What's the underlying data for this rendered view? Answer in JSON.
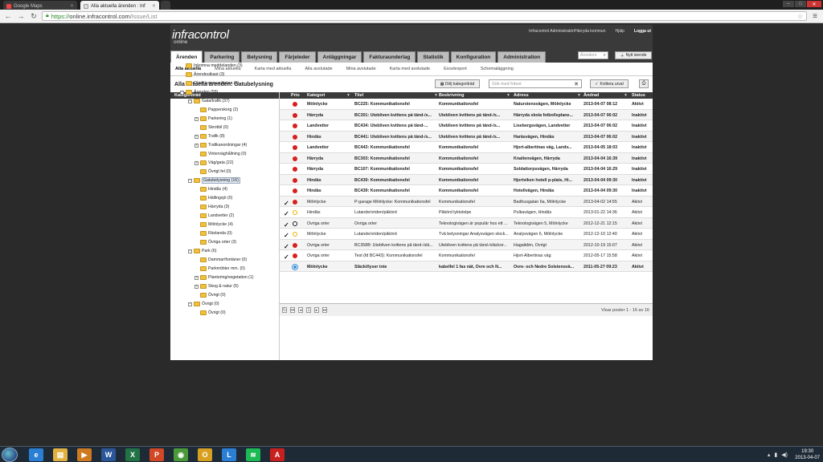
{
  "browser": {
    "tabs": [
      {
        "title": "Google Maps",
        "active": false
      },
      {
        "title": "Alla aktuella ärenden : Inf",
        "active": true
      }
    ],
    "url": {
      "scheme": "https://",
      "host": "online.infracontrol.com",
      "path": "/Issue/List"
    }
  },
  "app": {
    "logo": "infracontrol",
    "logo_sub": "online",
    "user": "Infracontrol Administratör/Härryda kommun",
    "help": "Hjälp",
    "logout": "Logga ut",
    "main_tabs": [
      "Ärenden",
      "Parkering",
      "Belysning",
      "Färjeleder",
      "Anläggningar",
      "Fakturaunderlag",
      "Statistik",
      "Konfiguration",
      "Administration"
    ],
    "search_placeholder": "Ärendenr",
    "new_issue": "Nytt ärende",
    "sub_nav": [
      "Alla aktuella",
      "Mina aktuella",
      "Karta med aktuella",
      "Alla avslutade",
      "Mina avslutade",
      "Karta med avslutade",
      "Excelexport",
      "Schemaläggning"
    ],
    "page_title": "Alla aktuella ärenden: Gatubelysning",
    "hide_tree": "Dölj kategoriträd",
    "freetext_placeholder": "Sök med fritext",
    "ack_button": "Kvittera urval",
    "tree_header": "Kategoriträd",
    "tree": [
      {
        "label": "Inkomna meddelanden (3)",
        "level": 0,
        "toggle": ""
      },
      {
        "label": "Ärendeutkast (3)",
        "level": 0,
        "toggle": ""
      },
      {
        "label": "Oläst kommunikation (1)",
        "level": 0,
        "toggle": ""
      },
      {
        "label": "Ärenden (59)",
        "level": 0,
        "toggle": "−"
      },
      {
        "label": "Gata/trafik (37)",
        "level": 1,
        "toggle": "−"
      },
      {
        "label": "Papperskorg (2)",
        "level": 2,
        "toggle": ""
      },
      {
        "label": "Parkering (1)",
        "level": 2,
        "toggle": "+"
      },
      {
        "label": "Skrotbil (0)",
        "level": 2,
        "toggle": ""
      },
      {
        "label": "Trafik (8)",
        "level": 2,
        "toggle": "+"
      },
      {
        "label": "Trafikanordningar (4)",
        "level": 2,
        "toggle": "+"
      },
      {
        "label": "Vinterväghållning (0)",
        "level": 2,
        "toggle": ""
      },
      {
        "label": "Väg/gata (22)",
        "level": 2,
        "toggle": "+"
      },
      {
        "label": "Övrigt fel (0)",
        "level": 2,
        "toggle": ""
      },
      {
        "label": "Gatubelysning (16)",
        "level": 1,
        "toggle": "−",
        "selected": true
      },
      {
        "label": "Hindås (4)",
        "level": 2,
        "toggle": ""
      },
      {
        "label": "Hällingsjö (0)",
        "level": 2,
        "toggle": ""
      },
      {
        "label": "Härryda (3)",
        "level": 2,
        "toggle": ""
      },
      {
        "label": "Landvetter (2)",
        "level": 2,
        "toggle": ""
      },
      {
        "label": "Mölnlycke (4)",
        "level": 2,
        "toggle": ""
      },
      {
        "label": "Rävlanda (0)",
        "level": 2,
        "toggle": ""
      },
      {
        "label": "Övriga orter (3)",
        "level": 2,
        "toggle": ""
      },
      {
        "label": "Park (6)",
        "level": 1,
        "toggle": "−"
      },
      {
        "label": "Dammar/fontäner (0)",
        "level": 2,
        "toggle": ""
      },
      {
        "label": "Parkmöbler mm. (0)",
        "level": 2,
        "toggle": ""
      },
      {
        "label": "Plantering/vegetation (1)",
        "level": 2,
        "toggle": "+"
      },
      {
        "label": "Skog & natur (5)",
        "level": 2,
        "toggle": "+"
      },
      {
        "label": "Övrigt (0)",
        "level": 2,
        "toggle": ""
      },
      {
        "label": "Övrigt (0)",
        "level": 1,
        "toggle": "−"
      },
      {
        "label": "Övrigt (0)",
        "level": 2,
        "toggle": ""
      }
    ],
    "grid_columns": [
      "Prio",
      "Kategori",
      "Titel",
      "Beskrivning",
      "Adress",
      "Ändrad",
      "Status"
    ],
    "rows": [
      {
        "check": "",
        "prio": "red",
        "kategori": "Mölnlycke",
        "titel": "BC225: Kommunikationsfel",
        "beskrivning": "Kommunikationsfel",
        "adress": "Naturstensvägen, Mölnlycke",
        "andrad": "2013-04-07 08:12",
        "status": "Aktivt",
        "bold": true
      },
      {
        "check": "",
        "prio": "red",
        "kategori": "Härryda",
        "titel": "BC301: Utebliven kvittens på tänd-/s...",
        "beskrivning": "Utebliven kvittens på tänd-/s...",
        "adress": "Härryda skola fotbollsplane...",
        "andrad": "2013-04-07 06:02",
        "status": "Inaktivt",
        "bold": true
      },
      {
        "check": "",
        "prio": "red",
        "kategori": "Landvetter",
        "titel": "BC434: Utebliven kvittens på tänd-...",
        "beskrivning": "Utebliven kvittens på tänd-/s...",
        "adress": "Lisebergsvägen, Landvetter",
        "andrad": "2013-04-07 06:02",
        "status": "Inaktivt",
        "bold": true
      },
      {
        "check": "",
        "prio": "red",
        "kategori": "Hindås",
        "titel": "BC441: Utebliven kvittens på tänd-/s...",
        "beskrivning": "Utebliven kvittens på tänd-/s...",
        "adress": "Haråsvägen, Hindås",
        "andrad": "2013-04-07 06:02",
        "status": "Inaktivt",
        "bold": true
      },
      {
        "check": "",
        "prio": "red",
        "kategori": "Landvetter",
        "titel": "BC443: Kommunikationsfel",
        "beskrivning": "Kommunikationsfel",
        "adress": "Hjort-albertinas väg, Landv...",
        "andrad": "2013-04-05 18:03",
        "status": "Inaktivt",
        "bold": true
      },
      {
        "check": "",
        "prio": "red",
        "kategori": "Härryda",
        "titel": "BC303: Kommunikationsfel",
        "beskrivning": "Kommunikationsfel",
        "adress": "Knaltenvägen, Härryda",
        "andrad": "2013-04-04 16:39",
        "status": "Inaktivt",
        "bold": true
      },
      {
        "check": "",
        "prio": "red",
        "kategori": "Härryda",
        "titel": "BC107: Kommunikationsfel",
        "beskrivning": "Kommunikationsfel",
        "adress": "Soldattorpsvägen, Härryda",
        "andrad": "2013-04-04 16:29",
        "status": "Inaktivt",
        "bold": true
      },
      {
        "check": "",
        "prio": "red",
        "kategori": "Hindås",
        "titel": "BC439: Kommunikationsfel",
        "beskrivning": "Kommunikationsfel",
        "adress": "Hjortviken hotell p-plats, Hi...",
        "andrad": "2013-04-04 09:30",
        "status": "Inaktivt",
        "bold": true
      },
      {
        "check": "",
        "prio": "red",
        "kategori": "Hindås",
        "titel": "BC439: Kommunikationsfel",
        "beskrivning": "Kommunikationsfel",
        "adress": "Hotellvägen, Hindås",
        "andrad": "2013-04-04 09:30",
        "status": "Inaktivt",
        "bold": true
      },
      {
        "check": "✓",
        "prio": "red",
        "kategori": "Mölnlycke",
        "titel": "P-garage Mölnlycke: Kommunikationsfel",
        "beskrivning": "Kommunikationsfel",
        "adress": "Badhusgatan 6a, Mölnlycke",
        "andrad": "2013-04-02 14:55",
        "status": "Aktivt",
        "bold": false
      },
      {
        "check": "✓",
        "prio": "yellow",
        "kategori": "Hindås",
        "titel": "Lutande/vriden/påkörd",
        "beskrivning": "Påkörd lyktstolpe",
        "adress": "Pulkavägen, Hindås",
        "andrad": "2013-01-22 14:36",
        "status": "Aktivt",
        "bold": false
      },
      {
        "check": "✓",
        "prio": "black",
        "kategori": "Övriga orter",
        "titel": "Övriga orter",
        "beskrivning": "Teknologivägen är populär hos ett ...",
        "adress": "Teknologivägen 5, Mölnlycke",
        "andrad": "2012-12-21 12:15",
        "status": "Aktivt",
        "bold": false
      },
      {
        "check": "✓",
        "prio": "yellow",
        "kategori": "Mölnlycke",
        "titel": "Lutande/vriden/påkörd",
        "beskrivning": "Två belysningar Analysvägen slock...",
        "adress": "Analysvägen 6, Mölnlycke",
        "andrad": "2012-12-10 12:40",
        "status": "Aktivt",
        "bold": false
      },
      {
        "check": "✓",
        "prio": "red",
        "kategori": "Övriga orter",
        "titel": "BC358B: Utebliven kvittens på tänd-/slä...",
        "beskrivning": "Utebliven kvittens på tänd-/släckor...",
        "adress": "Hagalidén, Övrigt",
        "andrad": "2012-10-19 15:07",
        "status": "Aktivt",
        "bold": false
      },
      {
        "check": "✓",
        "prio": "red",
        "kategori": "Övriga orter",
        "titel": "Test (fd BC443): Kommunikationsfel",
        "beskrivning": "Kommunikationsfel",
        "adress": "Hjort-Albertinas väg",
        "andrad": "2012-05-17 15:58",
        "status": "Aktivt",
        "bold": false
      },
      {
        "check": "",
        "prio": "blue",
        "kategori": "Mölnlycke",
        "titel": "Släckt/lyser inte",
        "beskrivning": "kabelfel 1 fas nät, Övre och N...",
        "adress": "Övre- och Nedre Solstensvä...",
        "andrad": "2011-05-27 09:23",
        "status": "Aktivt",
        "bold": true
      }
    ],
    "page_number": "1",
    "page_info": "Visar poster 1 - 16 av 16"
  },
  "taskbar": {
    "time": "19:30",
    "date": "2013-04-07",
    "apps": [
      "ie-icon",
      "explorer-icon",
      "media-icon",
      "word-icon",
      "excel-icon",
      "powerpoint-icon",
      "chrome-icon",
      "outlook-icon",
      "lync-icon",
      "spotify-icon",
      "acrobat-icon"
    ]
  },
  "colors": {
    "red": "#d81e1e",
    "yellow": "#e8b400",
    "black": "#111111",
    "blue": "#3b8fd8"
  }
}
